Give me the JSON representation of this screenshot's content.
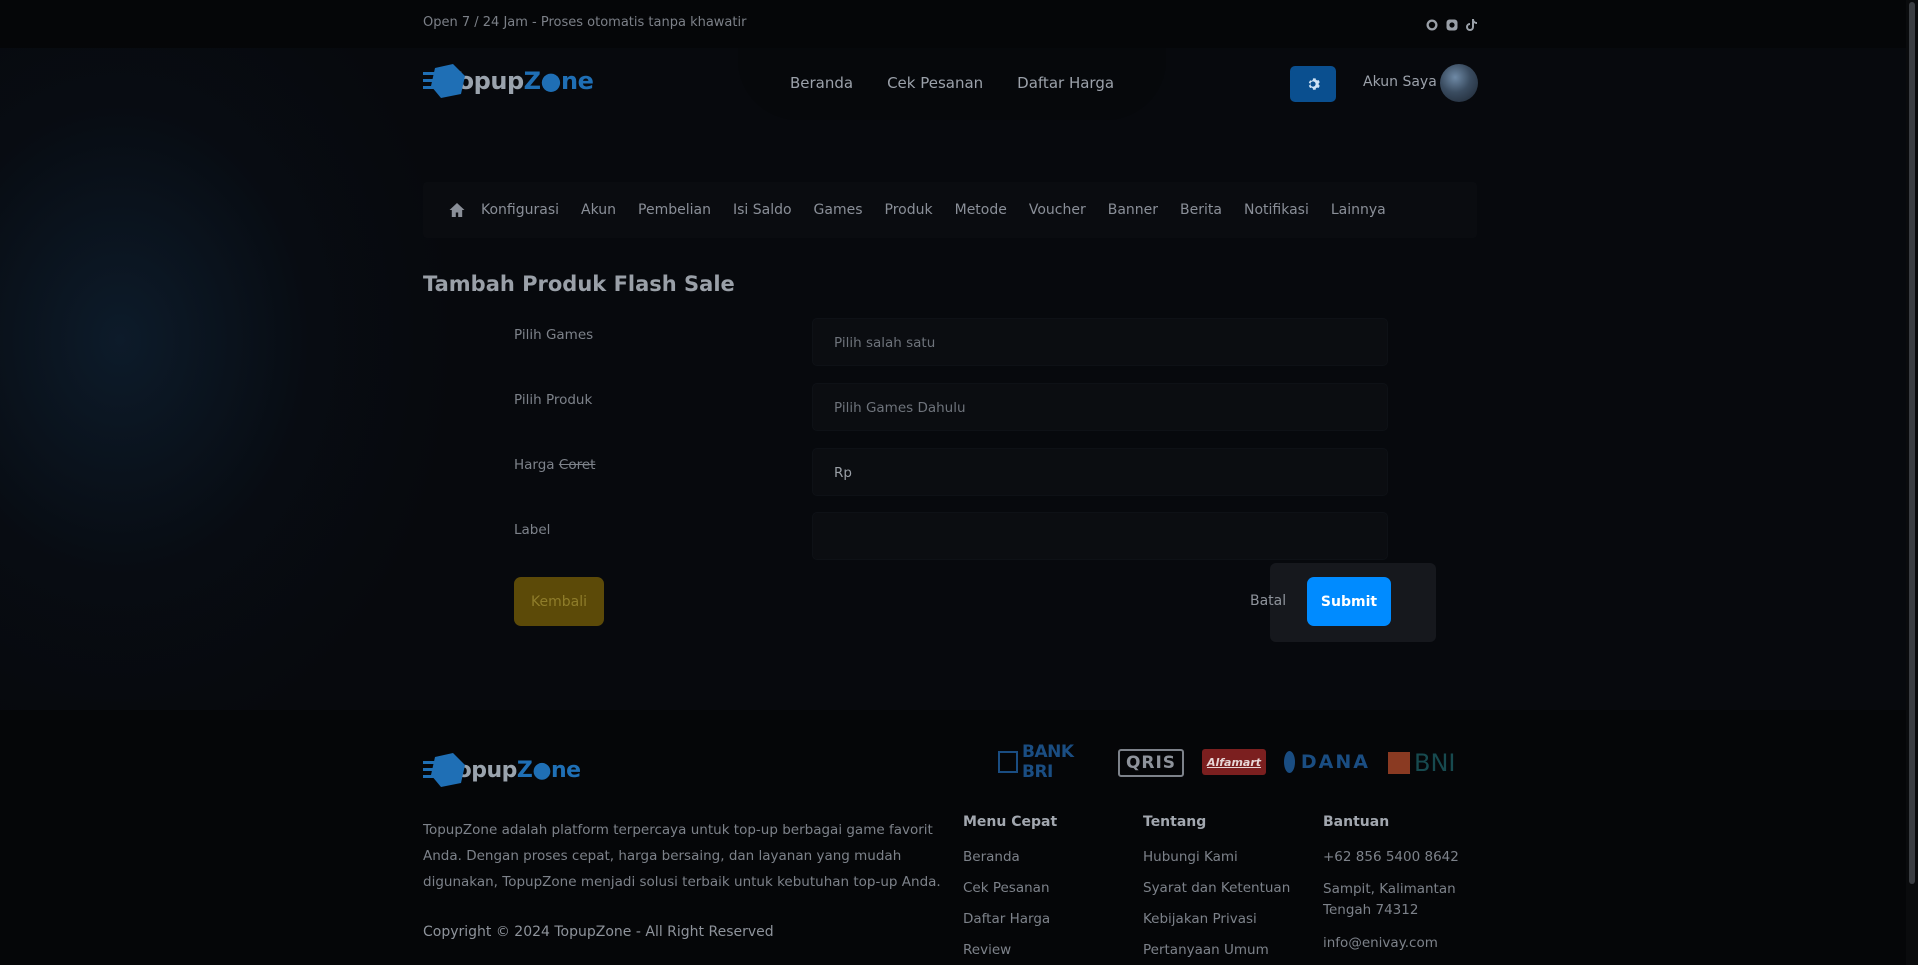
{
  "topbar": {
    "tagline": "Open 7 / 24 Jam - Proses otomatis tanpa khawatir",
    "social_icons": [
      "whatsapp-icon",
      "instagram-icon",
      "tiktok-icon"
    ]
  },
  "brand": {
    "name_part1": "Topup",
    "name_part2": "Z",
    "name_part3": "ne",
    "accent": "#1f6fb5"
  },
  "nav": {
    "links": [
      "Beranda",
      "Cek Pesanan",
      "Daftar Harga"
    ],
    "account_label": "Akun Saya"
  },
  "admin_menu": {
    "items": [
      "Konfigurasi",
      "Akun",
      "Pembelian",
      "Isi Saldo",
      "Games",
      "Produk",
      "Metode",
      "Voucher",
      "Banner",
      "Berita",
      "Notifikasi",
      "Lainnya"
    ]
  },
  "form": {
    "title": "Tambah Produk Flash Sale",
    "fields": [
      {
        "label": "Pilih Games",
        "value": "Pilih salah satu"
      },
      {
        "label": "Pilih Produk",
        "value": "Pilih Games Dahulu"
      },
      {
        "label": "Harga",
        "label_strike": "Coret",
        "value": "Rp"
      },
      {
        "label": "Label",
        "value": ""
      }
    ],
    "back_label": "Kembali",
    "cancel_label": "Batal",
    "submit_label": "Submit",
    "colors": {
      "submit": "#008bff",
      "back": "#5c4a08"
    }
  },
  "footer": {
    "description": "TopupZone adalah platform terpercaya untuk top-up berbagai game favorit Anda. Dengan proses cepat, harga bersaing, dan layanan yang mudah digunakan, TopupZone menjadi solusi terbaik untuk kebutuhan top-up Anda.",
    "copyright": "Copyright © 2024 TopupZone - All Right Reserved",
    "payments": [
      "BANK BRI",
      "QRIS",
      "Alfamart",
      "DANA",
      "BNI"
    ],
    "columns": [
      {
        "heading": "Menu Cepat",
        "items": [
          "Beranda",
          "Cek Pesanan",
          "Daftar Harga",
          "Review"
        ]
      },
      {
        "heading": "Tentang",
        "items": [
          "Hubungi Kami",
          "Syarat dan Ketentuan",
          "Kebijakan Privasi",
          "Pertanyaan Umum"
        ]
      },
      {
        "heading": "Bantuan",
        "items": [
          "+62 856 5400 8642",
          "Sampit, Kalimantan Tengah 74312",
          "info@enivay.com"
        ]
      }
    ]
  }
}
